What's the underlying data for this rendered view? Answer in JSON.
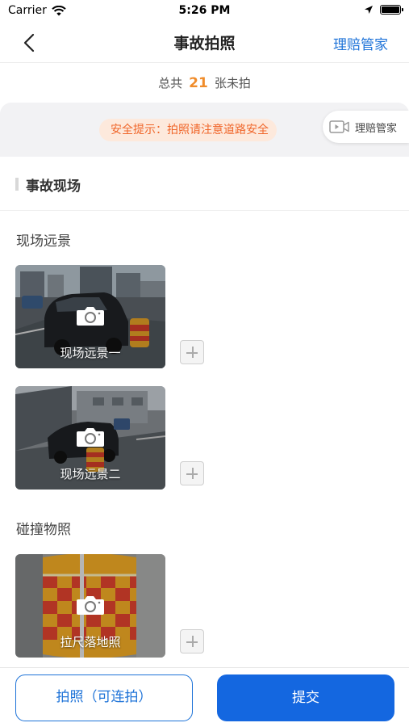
{
  "status_bar": {
    "carrier": "Carrier",
    "time": "5:26 PM"
  },
  "nav": {
    "title": "事故拍照",
    "right_link": "理赔管家"
  },
  "count": {
    "prefix": "总共",
    "value": "21",
    "suffix": "张未拍"
  },
  "safety_tip": "安全提示：拍照请注意道路安全",
  "butler_chip": {
    "label": "理赔管家"
  },
  "section": {
    "title": "事故现场"
  },
  "groups": [
    {
      "title": "现场远景",
      "photos": [
        {
          "label": "现场远景一"
        },
        {
          "label": "现场远景二"
        }
      ]
    },
    {
      "title": "碰撞物照",
      "photos": [
        {
          "label": "拉尺落地照"
        }
      ]
    }
  ],
  "buttons": {
    "continuous_shoot": "拍照（可连拍）",
    "submit": "提交"
  },
  "colors": {
    "accent": "#1e73d8",
    "primary_button": "#1467e0",
    "count_highlight": "#f08c2a",
    "tip_text": "#f0662a",
    "tip_bg": "#fde9dc"
  }
}
